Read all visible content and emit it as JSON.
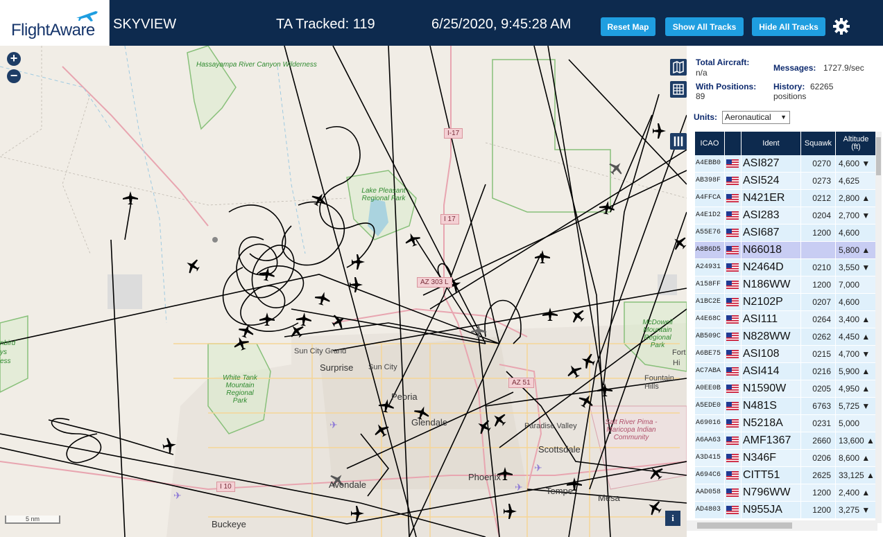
{
  "header": {
    "logo_text": "FlightAware",
    "app_name": "SKYVIEW",
    "ta_tracked": "TA Tracked: 119",
    "datetime": "6/25/2020, 9:45:28 AM",
    "reset_label": "Reset Map",
    "show_label": "Show All Tracks",
    "hide_label": "Hide All Tracks",
    "settings_icon": "gear-icon"
  },
  "map": {
    "zoom_in": "+",
    "zoom_out": "−",
    "scale_label": "5 nm",
    "info_label": "i",
    "cities": [
      "Sun City Grand",
      "Surprise",
      "Sun City",
      "Peoria",
      "Glendale",
      "Paradise Valley",
      "Scottsdale",
      "Phoenix",
      "Tempe",
      "Mesa",
      "Avondale",
      "Buckeye",
      "Fountain Hills"
    ],
    "parks": [
      "Hassayampa River Canyon Wilderness",
      "Lake Pleasant Regional Park",
      "White Tank Mountain Regional Park",
      "McDowell Mountain Regional Park",
      "Salt River Pima - Maricopa Indian Community"
    ],
    "shields": [
      "I-17",
      "I 17",
      "AZ 303 L",
      "AZ 51",
      "I 10"
    ],
    "edge_labels": [
      "Fort",
      "Hi",
      "nbird",
      "ys",
      "ess"
    ]
  },
  "stats": {
    "total_aircraft_label": "Total Aircraft:",
    "total_aircraft_value": "n/a",
    "with_positions_label": "With Positions:",
    "with_positions_value": "89",
    "messages_label": "Messages:",
    "messages_value": "1727.9/sec",
    "history_label": "History:",
    "history_value": "62265",
    "history_unit": "positions",
    "units_label": "Units:",
    "units_value": "Aeronautical"
  },
  "table": {
    "headers": {
      "icao": "ICAO",
      "ident": "Ident",
      "squawk": "Squawk",
      "altitude": "Altitude",
      "altitude_unit": "(ft)"
    },
    "rows": [
      {
        "icao": "A4EBB0",
        "ident": "ASI827",
        "squawk": "0270",
        "alt": "4,600 ▼"
      },
      {
        "icao": "AB398F",
        "ident": "ASI524",
        "squawk": "0273",
        "alt": "4,625"
      },
      {
        "icao": "A4FFCA",
        "ident": "N421ER",
        "squawk": "0212",
        "alt": "2,800 ▲"
      },
      {
        "icao": "A4E1D2",
        "ident": "ASI283",
        "squawk": "0204",
        "alt": "2,700 ▼"
      },
      {
        "icao": "A55E76",
        "ident": "ASI687",
        "squawk": "1200",
        "alt": "4,600"
      },
      {
        "icao": "A8B6D5",
        "ident": "N66018",
        "squawk": "",
        "alt": "5,800 ▲"
      },
      {
        "icao": "A24931",
        "ident": "N2464D",
        "squawk": "0210",
        "alt": "3,550 ▼"
      },
      {
        "icao": "A158FF",
        "ident": "N186WW",
        "squawk": "1200",
        "alt": "7,000"
      },
      {
        "icao": "A1BC2E",
        "ident": "N2102P",
        "squawk": "0207",
        "alt": "4,600"
      },
      {
        "icao": "A4E68C",
        "ident": "ASI111",
        "squawk": "0264",
        "alt": "3,400 ▲"
      },
      {
        "icao": "AB509C",
        "ident": "N828WW",
        "squawk": "0262",
        "alt": "4,450 ▲"
      },
      {
        "icao": "A6BE75",
        "ident": "ASI108",
        "squawk": "0215",
        "alt": "4,700 ▼"
      },
      {
        "icao": "AC7ABA",
        "ident": "ASI414",
        "squawk": "0216",
        "alt": "5,900 ▲"
      },
      {
        "icao": "A0EE0B",
        "ident": "N1590W",
        "squawk": "0205",
        "alt": "4,950 ▲"
      },
      {
        "icao": "A5EDE0",
        "ident": "N481S",
        "squawk": "6763",
        "alt": "5,725 ▼"
      },
      {
        "icao": "A69016",
        "ident": "N5218A",
        "squawk": "0231",
        "alt": "5,000"
      },
      {
        "icao": "A6AA63",
        "ident": "AMF1367",
        "squawk": "2660",
        "alt": "13,600 ▲"
      },
      {
        "icao": "A3D415",
        "ident": "N346F",
        "squawk": "0206",
        "alt": "8,600 ▲"
      },
      {
        "icao": "A694C6",
        "ident": "CITT51",
        "squawk": "2625",
        "alt": "33,125 ▲"
      },
      {
        "icao": "AAD058",
        "ident": "N796WW",
        "squawk": "1200",
        "alt": "2,400 ▲"
      },
      {
        "icao": "AD4803",
        "ident": "N955JA",
        "squawk": "1200",
        "alt": "3,275 ▼"
      }
    ],
    "selected_row": 5
  }
}
